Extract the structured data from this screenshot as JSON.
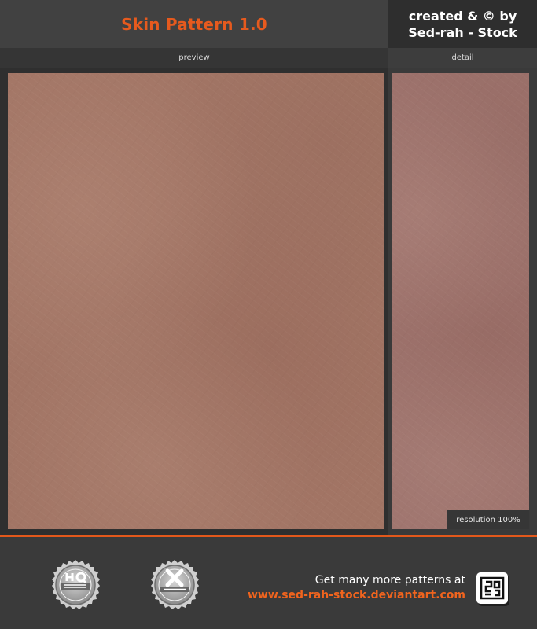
{
  "header": {
    "title": "Skin Pattern 1.0",
    "credit_line1": "created & © by",
    "credit_line2": "Sed-rah - Stock"
  },
  "labels": {
    "preview": "preview",
    "detail": "detail",
    "resolution": "resolution 100%"
  },
  "footer": {
    "promo_line1": "Get many more patterns at",
    "promo_line2": "www.sed-rah-stock.deviantart.com",
    "badges": [
      {
        "icon": "hq-stock-seal-icon"
      },
      {
        "icon": "xclusive-seal-icon"
      }
    ],
    "logo_icon": "sed-rah-logo-icon"
  },
  "colors": {
    "accent": "#e3581b",
    "skin": "#a27565"
  }
}
